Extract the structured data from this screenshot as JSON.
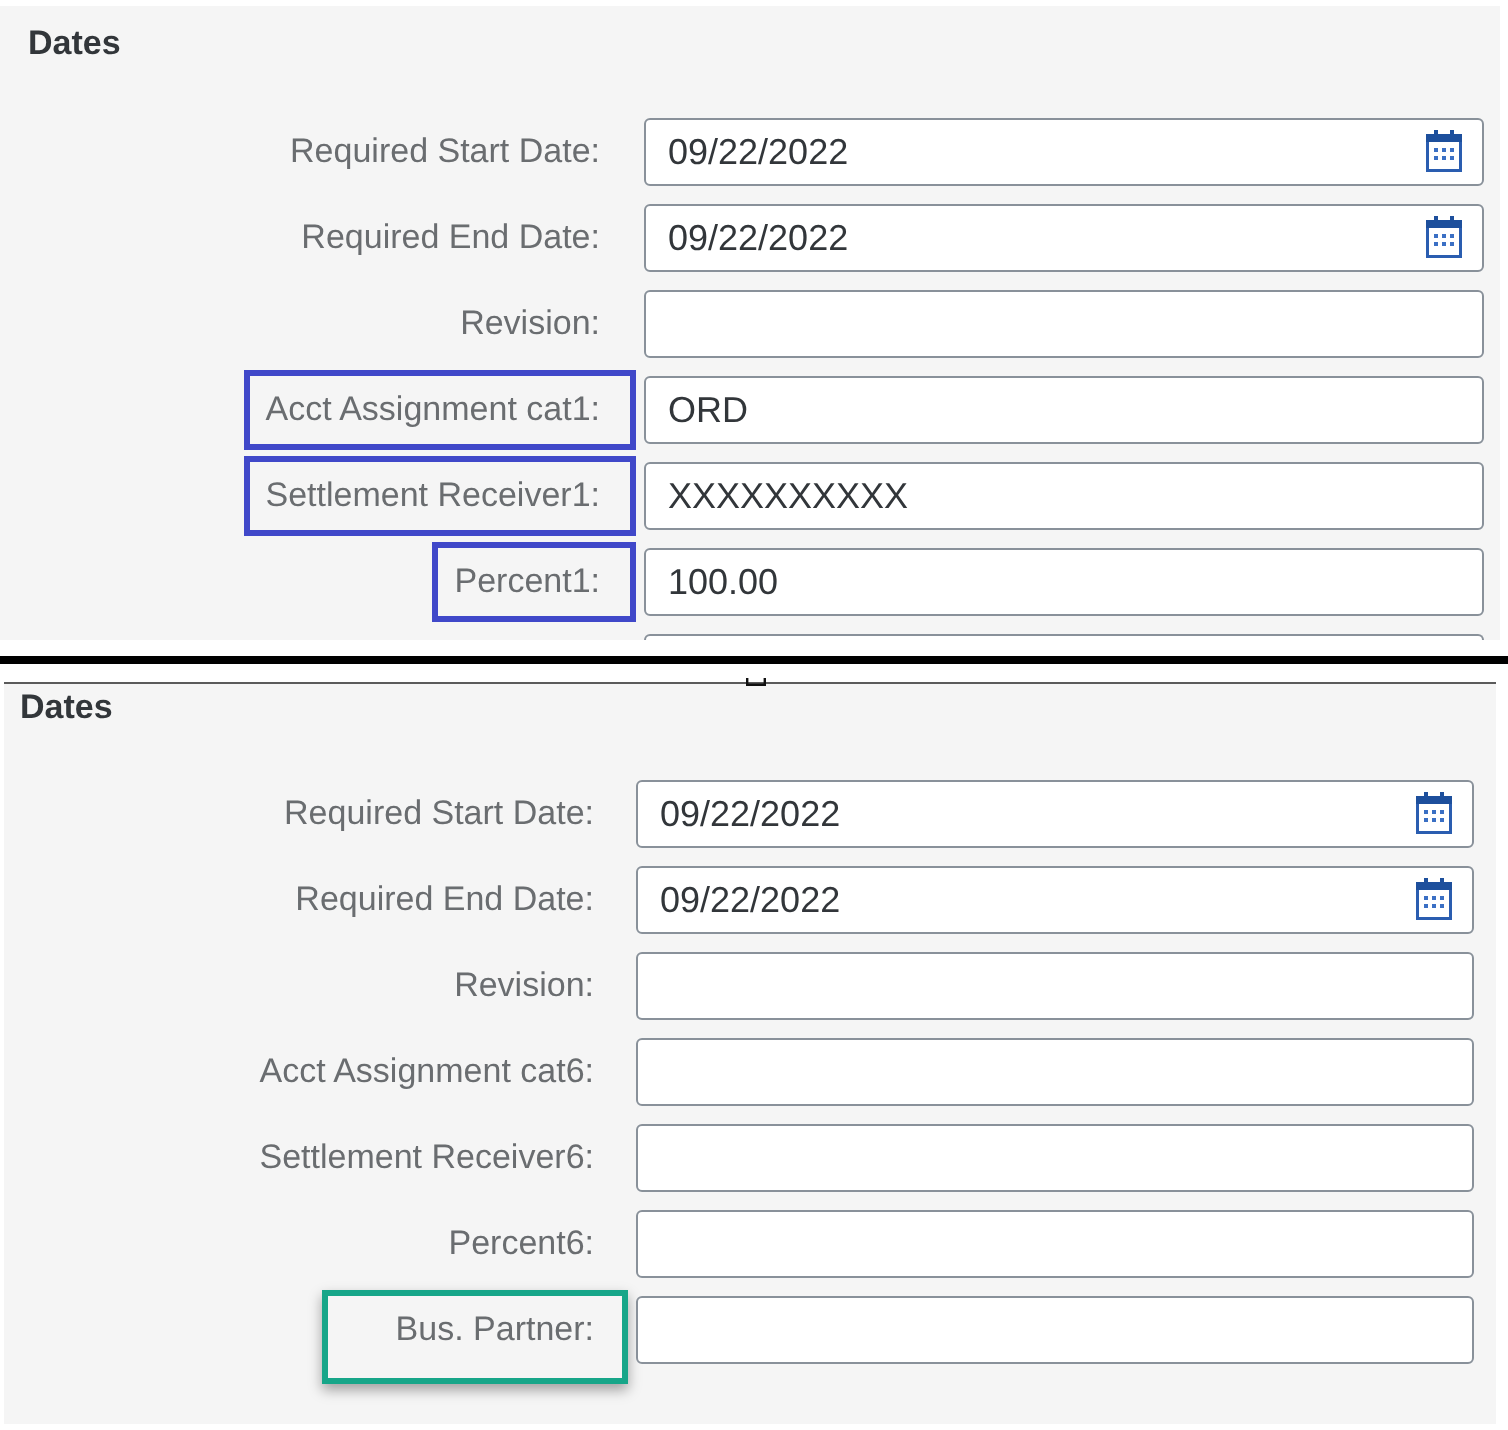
{
  "panels": [
    {
      "title": "Dates",
      "color": "#4048c9",
      "cut_off_row": true,
      "rows": [
        {
          "label": "Required Start Date:",
          "kind": "date",
          "value": "09/22/2022",
          "highlighted": false
        },
        {
          "label": "Required End Date:",
          "kind": "date",
          "value": "09/22/2022",
          "highlighted": false
        },
        {
          "label": "Revision:",
          "kind": "text",
          "highlighted": false
        },
        {
          "label": "Acct Assignment cat1:",
          "kind": "text",
          "value": "ORD",
          "highlighted": true
        },
        {
          "label": "Settlement Receiver1:",
          "kind": "text",
          "value": "XXXXXXXXXX",
          "highlighted": true
        },
        {
          "label": "Percent1:",
          "kind": "text",
          "value": "100.00",
          "highlighted": true
        }
      ]
    },
    {
      "title": "Dates",
      "color": "#17a689",
      "cut_off_row": false,
      "rows": [
        {
          "label": "Required Start Date:",
          "kind": "date",
          "value": "09/22/2022",
          "highlighted": false
        },
        {
          "label": "Required End Date:",
          "kind": "date",
          "value": "09/22/2022",
          "highlighted": false
        },
        {
          "label": "Revision:",
          "kind": "text",
          "highlighted": false
        },
        {
          "label": "Acct Assignment cat6:",
          "kind": "text",
          "highlighted": false
        },
        {
          "label": "Settlement Receiver6:",
          "kind": "text",
          "highlighted": false
        },
        {
          "label": "Percent6:",
          "kind": "text",
          "highlighted": false
        },
        {
          "label": "Bus. Partner:",
          "kind": "text",
          "highlighted": true
        }
      ]
    }
  ]
}
